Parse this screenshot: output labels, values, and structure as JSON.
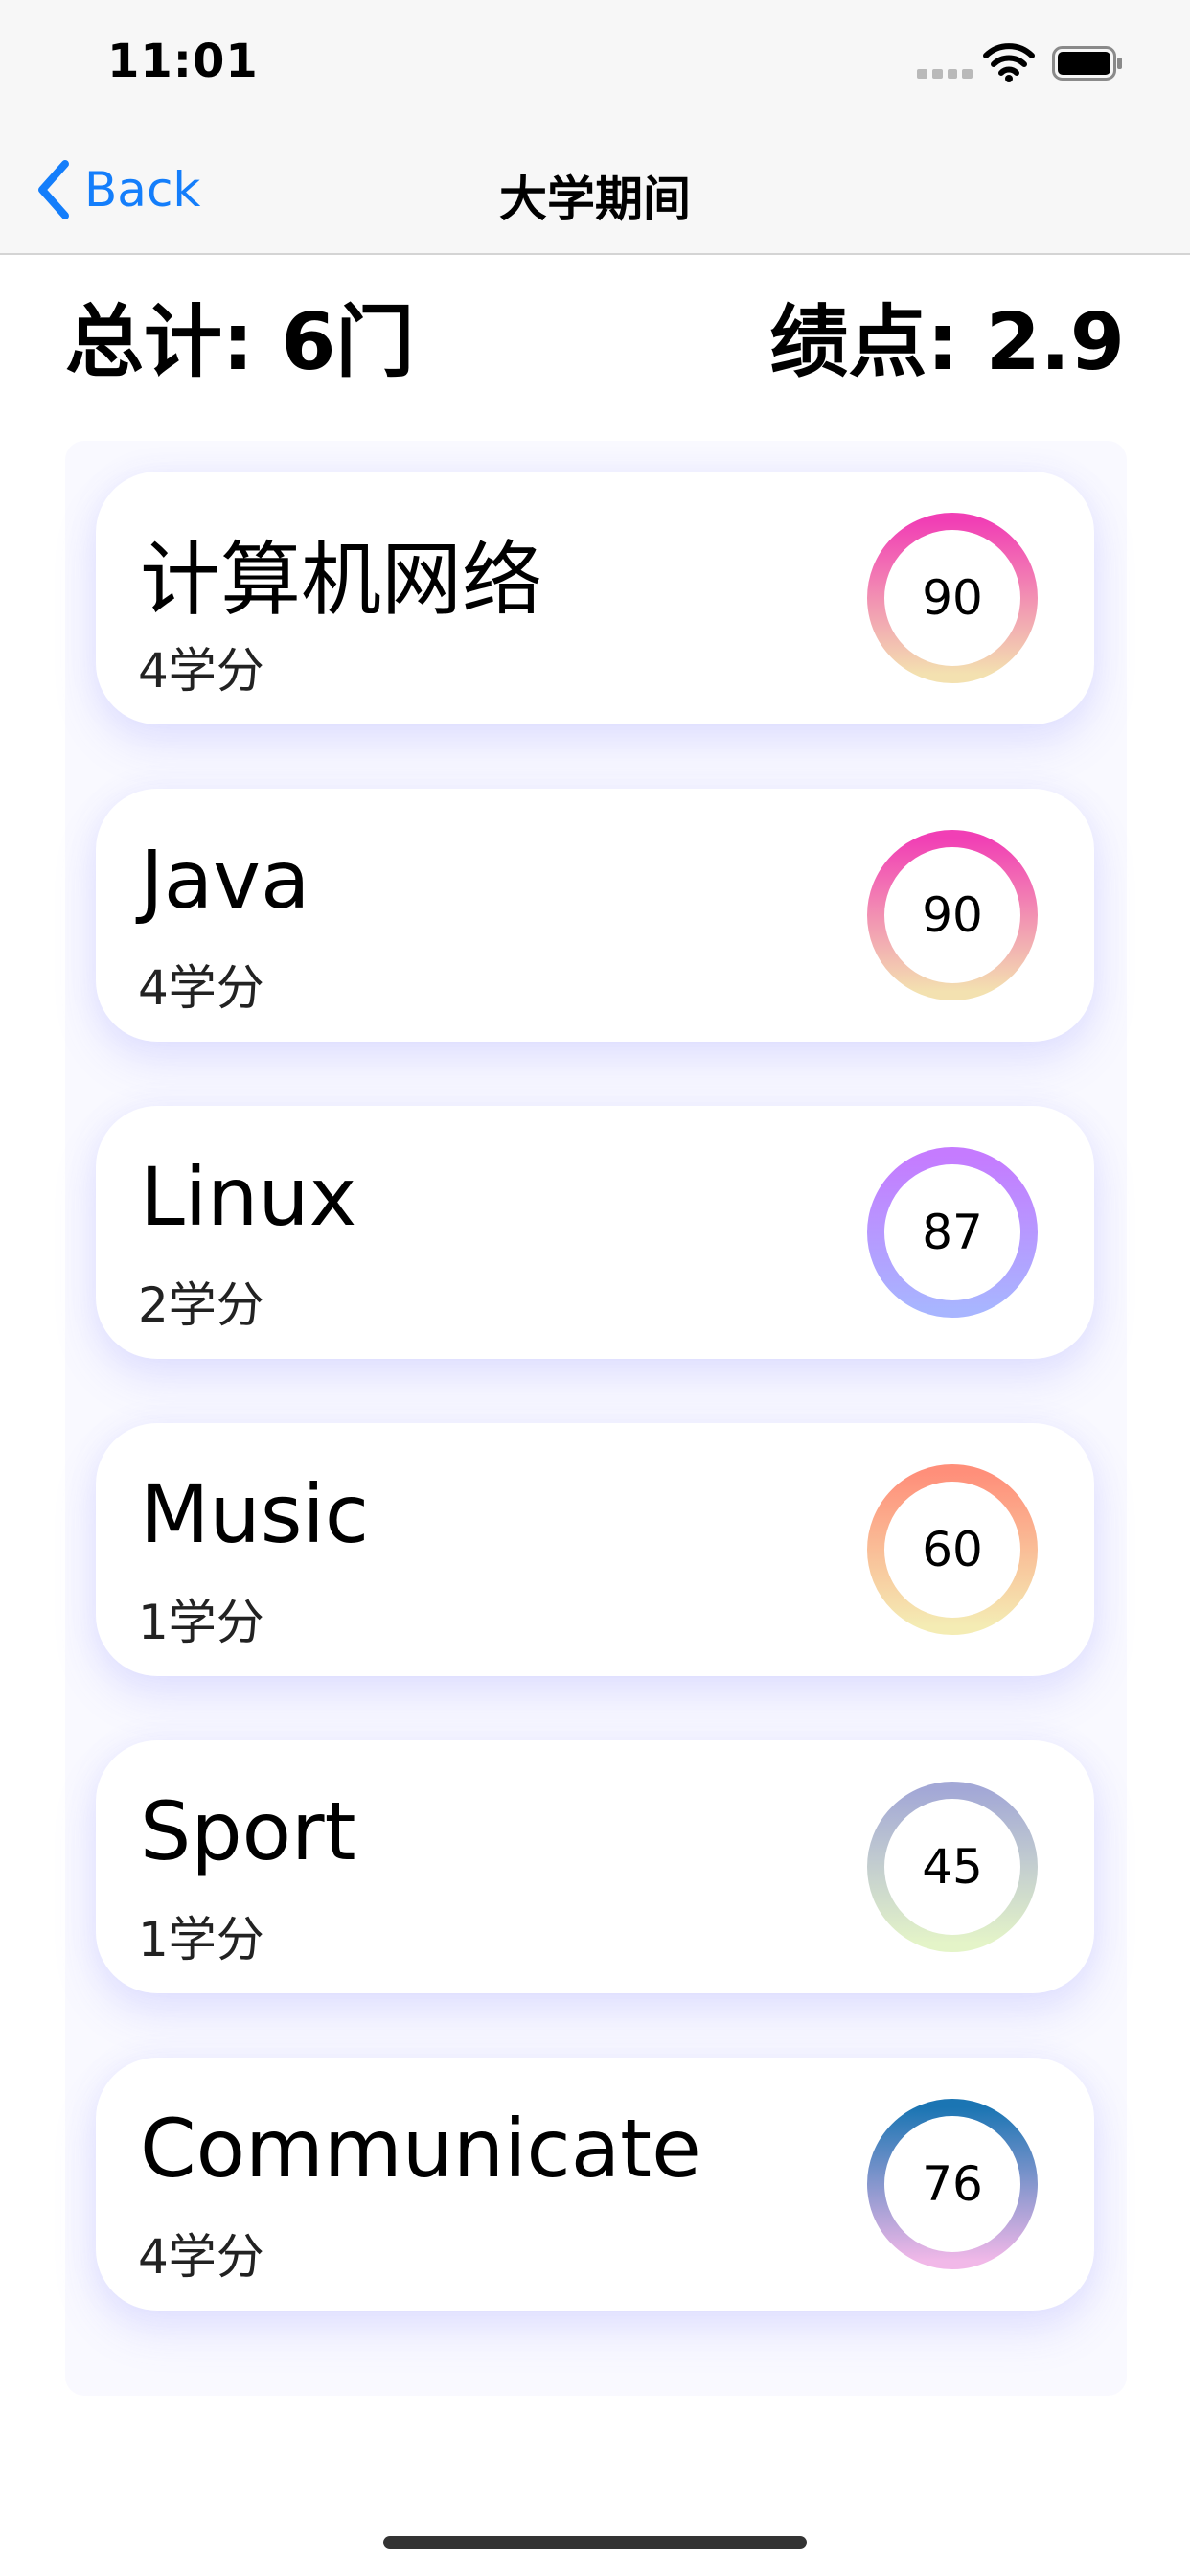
{
  "status_bar": {
    "time": "11:01"
  },
  "nav": {
    "back_label": "Back",
    "title": "大学期间"
  },
  "summary": {
    "total": "总计: 6门",
    "gpa": "绩点: 2.9"
  },
  "courses": [
    {
      "name": "计算机网络",
      "credit": "4学分",
      "score": "90",
      "gradient": [
        "#f13fb5",
        "#f3e1b0"
      ]
    },
    {
      "name": "Java",
      "credit": "4学分",
      "score": "90",
      "gradient": [
        "#f13fb5",
        "#f3e1b0"
      ]
    },
    {
      "name": "Linux",
      "credit": "2学分",
      "score": "87",
      "gradient": [
        "#c57bff",
        "#a8b5ff"
      ]
    },
    {
      "name": "Music",
      "credit": "1学分",
      "score": "60",
      "gradient": [
        "#ff8f7a",
        "#f4ecb4"
      ]
    },
    {
      "name": "Sport",
      "credit": "1学分",
      "score": "45",
      "gradient": [
        "#a3a8d6",
        "#e4f4c8"
      ]
    },
    {
      "name": "Communicate",
      "credit": "4学分",
      "score": "76",
      "gradient": [
        "#1b75b3",
        "#f1b8e8"
      ]
    }
  ],
  "colors": {
    "accent": "#147efb",
    "panel_bg": "#f9f9ff"
  }
}
